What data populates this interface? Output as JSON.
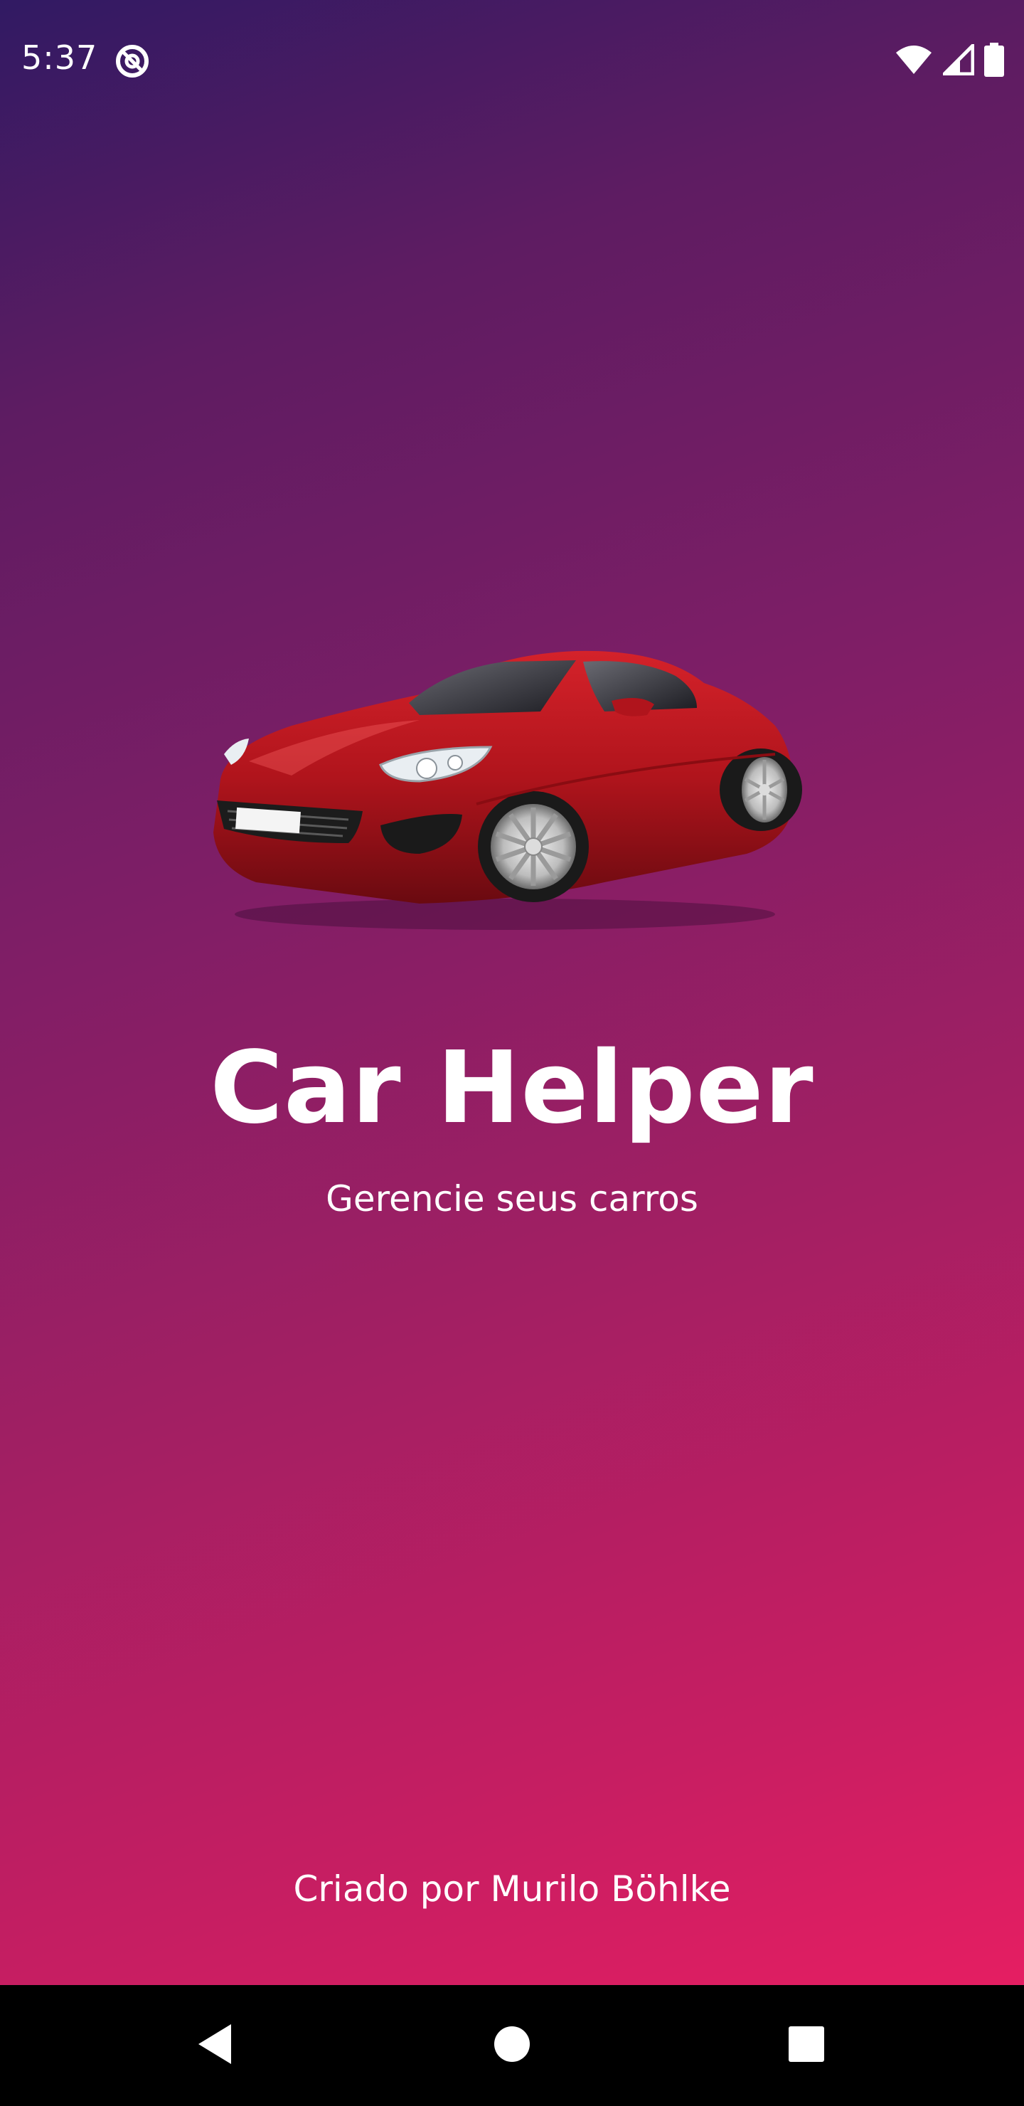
{
  "status_bar": {
    "time": "5:37",
    "left_icon": "do-not-disturb-icon",
    "right_icons": [
      "wifi-icon",
      "cellular-signal-icon",
      "battery-icon"
    ]
  },
  "app": {
    "title": "Car Helper",
    "subtitle": "Gerencie seus carros",
    "credit": "Criado por Murilo Böhlke",
    "illustration": "red-sports-car"
  },
  "nav_bar": {
    "buttons": [
      "back-icon",
      "home-icon",
      "recents-icon"
    ]
  },
  "colors": {
    "gradient_top": "#311a63",
    "gradient_bottom": "#e51e62",
    "text": "#ffffff",
    "nav_background": "#000000"
  }
}
